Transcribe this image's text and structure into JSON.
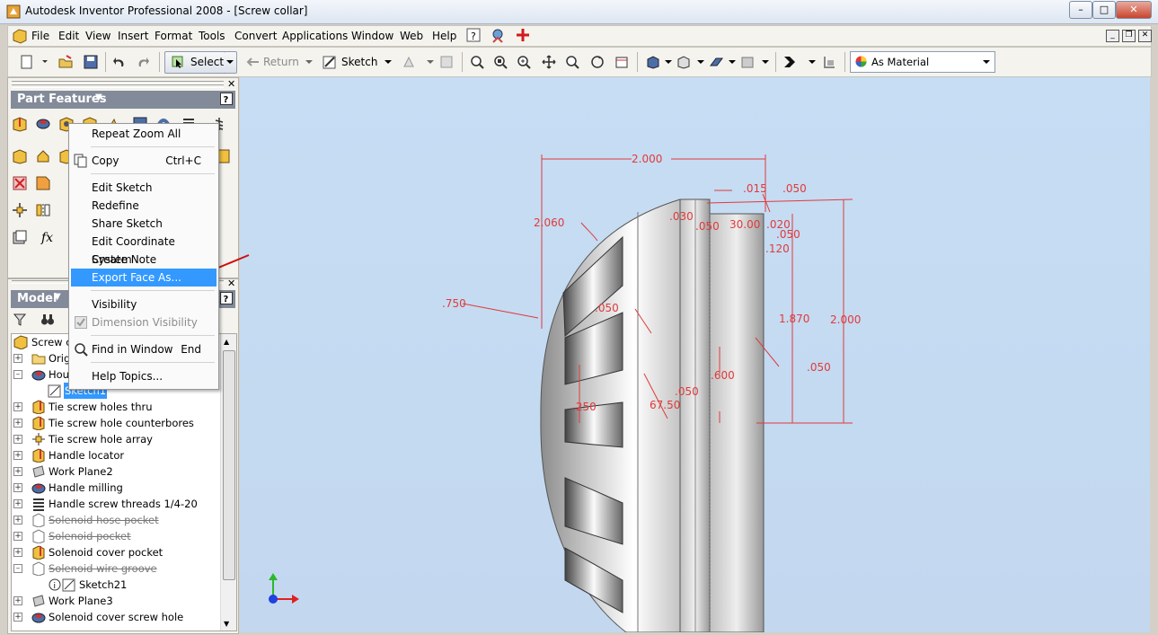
{
  "window": {
    "title": "Autodesk Inventor Professional 2008 - [Screw collar]"
  },
  "menubar": {
    "items": [
      "File",
      "Edit",
      "View",
      "Insert",
      "Format",
      "Tools",
      "Convert",
      "Applications",
      "Window",
      "Web",
      "Help"
    ]
  },
  "toolbar": {
    "select_label": "Select",
    "return_label": "Return",
    "sketch_label": "Sketch",
    "appearance_value": "As Material"
  },
  "part_features": {
    "title": "Part Features"
  },
  "model_browser": {
    "title": "Model",
    "tree": [
      {
        "label": "Screw co",
        "state": "normal"
      },
      {
        "label": "Origi",
        "state": "normal"
      },
      {
        "label": "Hous",
        "state": "normal"
      },
      {
        "label": "Sketch1",
        "state": "selected"
      },
      {
        "label": "Tie screw holes thru",
        "state": "normal"
      },
      {
        "label": "Tie screw hole counterbores",
        "state": "normal"
      },
      {
        "label": "Tie screw hole array",
        "state": "normal"
      },
      {
        "label": "Handle locator",
        "state": "normal"
      },
      {
        "label": "Work Plane2",
        "state": "normal"
      },
      {
        "label": "Handle milling",
        "state": "normal"
      },
      {
        "label": "Handle screw threads 1/4-20",
        "state": "normal"
      },
      {
        "label": "Solenoid hose pocket",
        "state": "suppressed"
      },
      {
        "label": "Solenoid pocket",
        "state": "suppressed"
      },
      {
        "label": "Solenoid cover pocket",
        "state": "normal"
      },
      {
        "label": "Solenoid wire groove",
        "state": "suppressed"
      },
      {
        "label": "Sketch21",
        "state": "normal"
      },
      {
        "label": "Work Plane3",
        "state": "normal"
      },
      {
        "label": "Solenoid cover screw hole",
        "state": "normal"
      }
    ]
  },
  "context_menu": {
    "items": [
      {
        "label": "Repeat Zoom All",
        "shortcut": ""
      },
      {
        "label": "Copy",
        "shortcut": "Ctrl+C"
      },
      {
        "label": "Edit Sketch",
        "shortcut": ""
      },
      {
        "label": "Redefine",
        "shortcut": ""
      },
      {
        "label": "Share Sketch",
        "shortcut": ""
      },
      {
        "label": "Edit Coordinate System",
        "shortcut": ""
      },
      {
        "label": "Create Note",
        "shortcut": ""
      },
      {
        "label": "Export Face As...",
        "shortcut": ""
      },
      {
        "label": "Visibility",
        "shortcut": ""
      },
      {
        "label": "Dimension Visibility",
        "shortcut": ""
      },
      {
        "label": "Find in Window",
        "shortcut": "End"
      },
      {
        "label": "Help Topics...",
        "shortcut": ""
      }
    ],
    "highlighted": "Export Face As..."
  },
  "dimensions": {
    "d_2000_top": "2.000",
    "d_015": ".015",
    "d_050_a": ".050",
    "d_2060": "2.060",
    "d_030": ".030",
    "d_050_b": ".050",
    "d_3000": "30.00",
    "d_020": ".020",
    "d_050_c": ".050",
    "d_120": ".120",
    "d_750": ".750",
    "d_050_d": ".050",
    "d_1870": "1.870",
    "d_2000_right": "2.000",
    "d_050_e": ".050",
    "d_600": ".600",
    "d_050_f": ".050",
    "d_6750": "67.50",
    "d_250": ".250"
  },
  "colors": {
    "dimension": "#e03a3a",
    "viewport_bg": "#c5dbf2",
    "menu_highlight": "#3399ff"
  }
}
